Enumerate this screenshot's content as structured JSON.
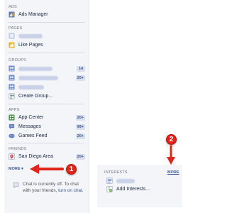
{
  "sections": {
    "ads": {
      "header": "ADS",
      "items": [
        {
          "label": "Ads Manager",
          "icon": "ads-manager-icon"
        }
      ]
    },
    "pages": {
      "header": "PAGES",
      "items": [
        {
          "label": "",
          "icon": "page-icon",
          "blurred": true
        },
        {
          "label": "Like Pages",
          "icon": "like-pages-icon"
        }
      ]
    },
    "groups": {
      "header": "GROUPS",
      "items": [
        {
          "label": "",
          "icon": "group-icon",
          "blurred": true,
          "badge": "14"
        },
        {
          "label": "",
          "icon": "group-icon",
          "blurred": true,
          "badge": "20+"
        },
        {
          "label": "",
          "icon": "group-icon",
          "blurred": true
        },
        {
          "label": "Create Group...",
          "icon": "create-group-icon"
        }
      ]
    },
    "apps": {
      "header": "APPS",
      "items": [
        {
          "label": "App Center",
          "icon": "app-center-icon",
          "badge": "20+"
        },
        {
          "label": "Messages",
          "icon": "messages-icon",
          "badge": "99+"
        },
        {
          "label": "Games Feed",
          "icon": "games-feed-icon",
          "badge": "20+"
        }
      ]
    },
    "friends": {
      "header": "FRIENDS",
      "items": [
        {
          "label": "San Diego Area",
          "icon": "friends-list-icon",
          "badge": "20+"
        }
      ]
    },
    "more": {
      "label": "MORE",
      "caret": "▾"
    }
  },
  "chat": {
    "off_text": "Chat is currently off. To chat with your friends, ",
    "turn_on": "turn on chat."
  },
  "interests_panel": {
    "header": "INTERESTS",
    "more": "MORE",
    "items": [
      {
        "label": "",
        "icon": "interest-list-icon",
        "blurred": true
      },
      {
        "label": "Add Interests...",
        "icon": "add-interests-icon"
      }
    ]
  },
  "annotations": {
    "callout_1": "1",
    "callout_2": "2",
    "arrow_color": "#e0251b"
  },
  "colors": {
    "link": "#3b5998",
    "badge_bg": "#d8dfea",
    "sidebar_bg": "#f4f5f8"
  }
}
